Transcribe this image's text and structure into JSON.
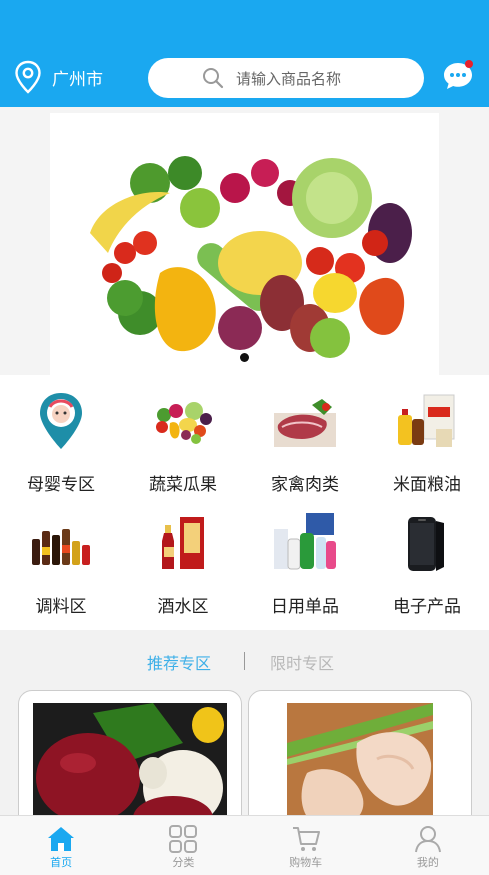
{
  "header": {
    "location": "广州市",
    "search_placeholder": "请输入商品名称",
    "icons": {
      "location": "location-pin-icon",
      "search": "search-icon",
      "message": "chat-bubble-icon"
    },
    "accent_color": "#1aa8f0"
  },
  "banner": {
    "image": "fresh-fruits-vegetables-photo",
    "active_dot_index": 0
  },
  "categories": [
    {
      "label": "母婴专区",
      "icon": "baby-mother-icon"
    },
    {
      "label": "蔬菜瓜果",
      "icon": "vegetables-fruits-image"
    },
    {
      "label": "家禽肉类",
      "icon": "meat-image"
    },
    {
      "label": "米面粮油",
      "icon": "grain-oil-image"
    },
    {
      "label": "调料区",
      "icon": "seasoning-bottles-image"
    },
    {
      "label": "酒水区",
      "icon": "liquor-image"
    },
    {
      "label": "日用单品",
      "icon": "daily-goods-image"
    },
    {
      "label": "电子产品",
      "icon": "smartphone-image"
    }
  ],
  "tabs": {
    "recommended": "推荐专区",
    "limited": "限时专区",
    "active_color": "#3fb0e8"
  },
  "products": [
    {
      "image": "red-apple-photo"
    },
    {
      "image": "chicken-wings-photo"
    }
  ],
  "nav": [
    {
      "label": "首页",
      "icon": "home-icon",
      "active": true
    },
    {
      "label": "分类",
      "icon": "grid-icon",
      "active": false
    },
    {
      "label": "购物车",
      "icon": "cart-icon",
      "active": false
    },
    {
      "label": "我的",
      "icon": "user-icon",
      "active": false
    }
  ]
}
